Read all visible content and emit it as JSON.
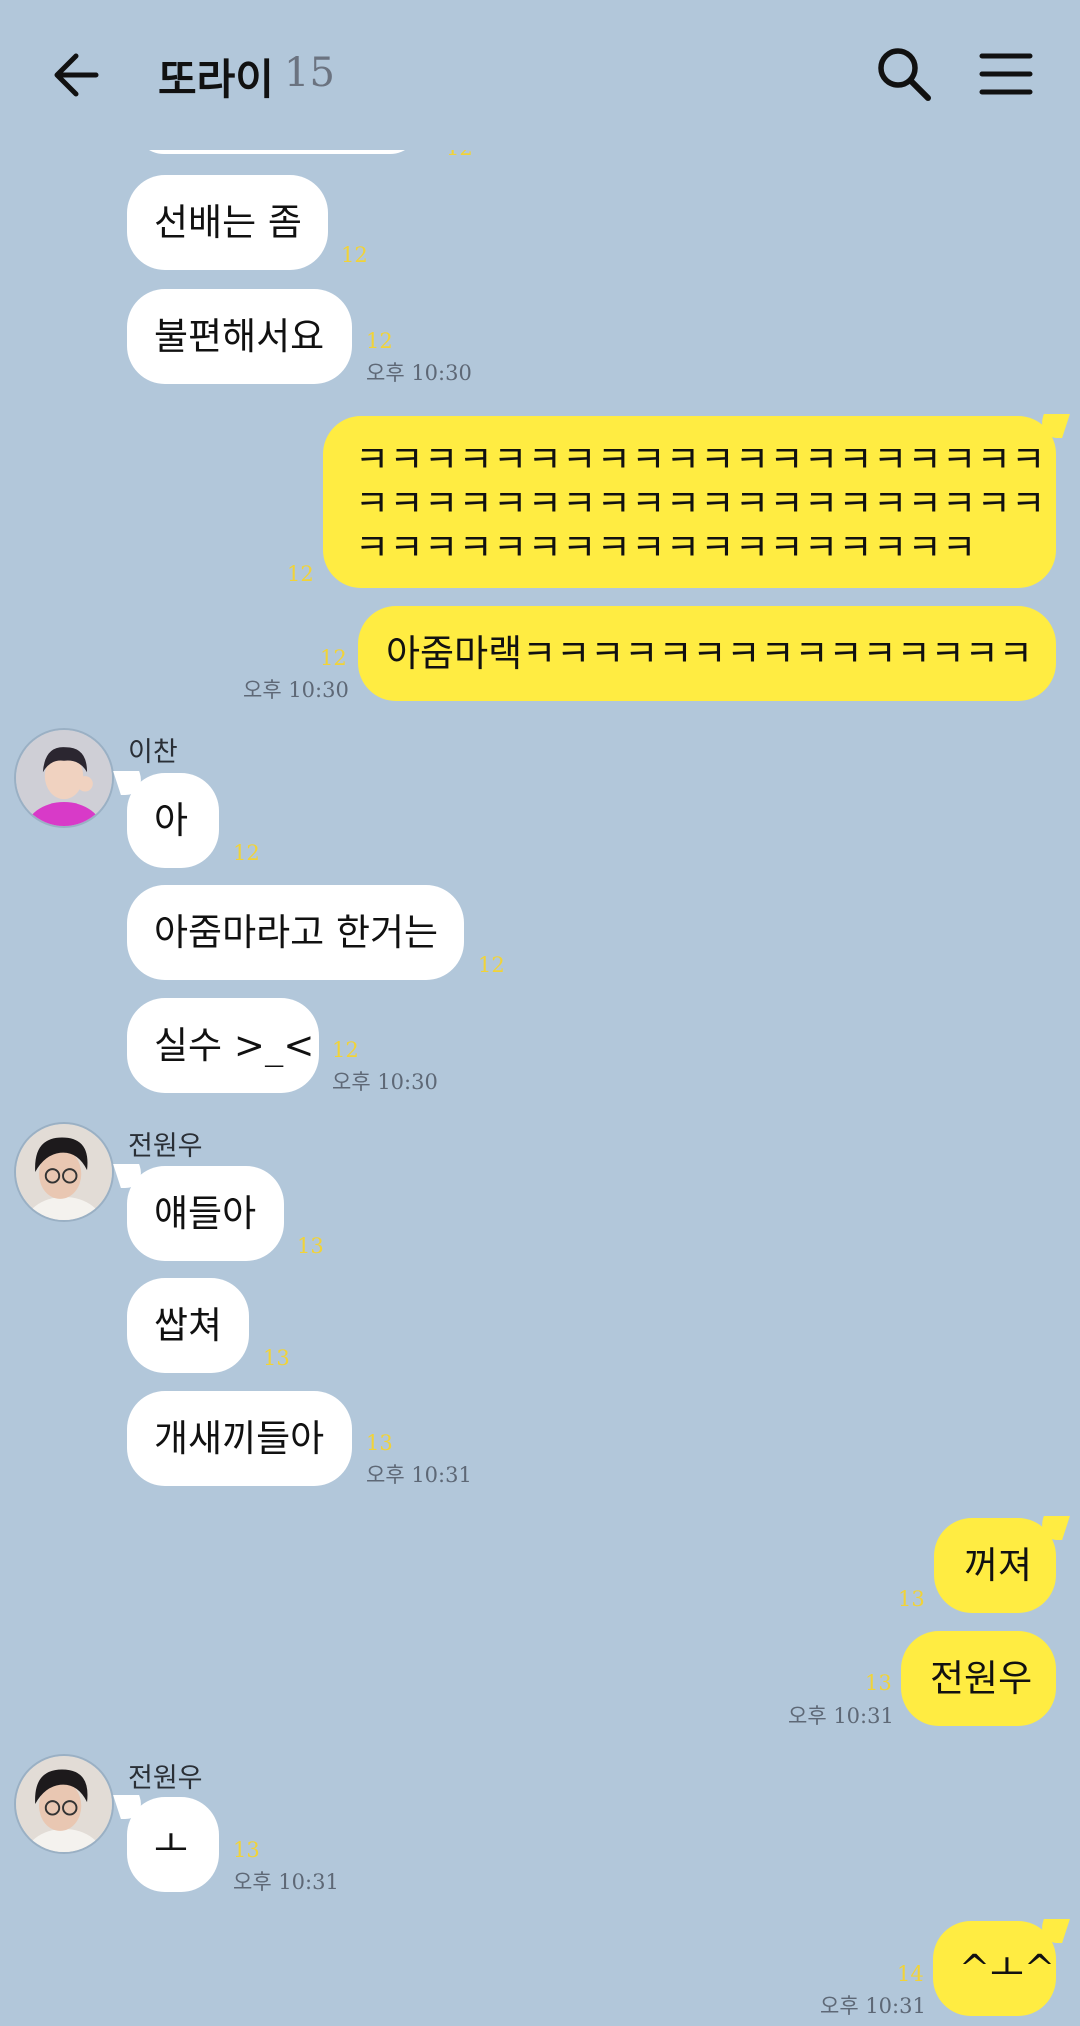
{
  "header": {
    "title": "또라이",
    "member_count": "15"
  },
  "messages": {
    "m0": {
      "unread": "12"
    },
    "m1": {
      "text": "선배는 좀",
      "unread": "12"
    },
    "m2": {
      "text": "불편해서요",
      "unread": "12",
      "time": "오후 10:30"
    },
    "m3": {
      "line1": "ㅋㅋㅋㅋㅋㅋㅋㅋㅋㅋㅋㅋㅋㅋㅋㅋㅋㅋㅋㅋ",
      "line2": "ㅋㅋㅋㅋㅋㅋㅋㅋㅋㅋㅋㅋㅋㅋㅋㅋㅋㅋㅋㅋ",
      "line3": "ㅋㅋㅋㅋㅋㅋㅋㅋㅋㅋㅋㅋㅋㅋㅋㅋㅋㅋ",
      "unread": "12"
    },
    "m4": {
      "text": "아줌마랙ㅋㅋㅋㅋㅋㅋㅋㅋㅋㅋㅋㅋㅋㅋㅋ",
      "unread": "12",
      "time": "오후 10:30"
    },
    "g1": {
      "sender": "이찬"
    },
    "m5": {
      "text": "아",
      "unread": "12"
    },
    "m6": {
      "text": "아줌마라고 한거는",
      "unread": "12"
    },
    "m7": {
      "text": "실수 >_<",
      "unread": "12",
      "time": "오후 10:30"
    },
    "g2": {
      "sender": "전원우"
    },
    "m8": {
      "text": "얘들아",
      "unread": "13"
    },
    "m9": {
      "text": "쌉쳐",
      "unread": "13"
    },
    "m10": {
      "text": "개새끼들아",
      "unread": "13",
      "time": "오후 10:31"
    },
    "m11": {
      "text": "꺼져",
      "unread": "13"
    },
    "m12": {
      "text": "전원우",
      "unread": "13",
      "time": "오후 10:31"
    },
    "g3": {
      "sender": "전원우"
    },
    "m13": {
      "text": "ㅗ",
      "unread": "13",
      "time": "오후 10:31"
    },
    "m14": {
      "text": "^ㅗ^",
      "unread": "14",
      "time": "오후 10:31"
    }
  }
}
